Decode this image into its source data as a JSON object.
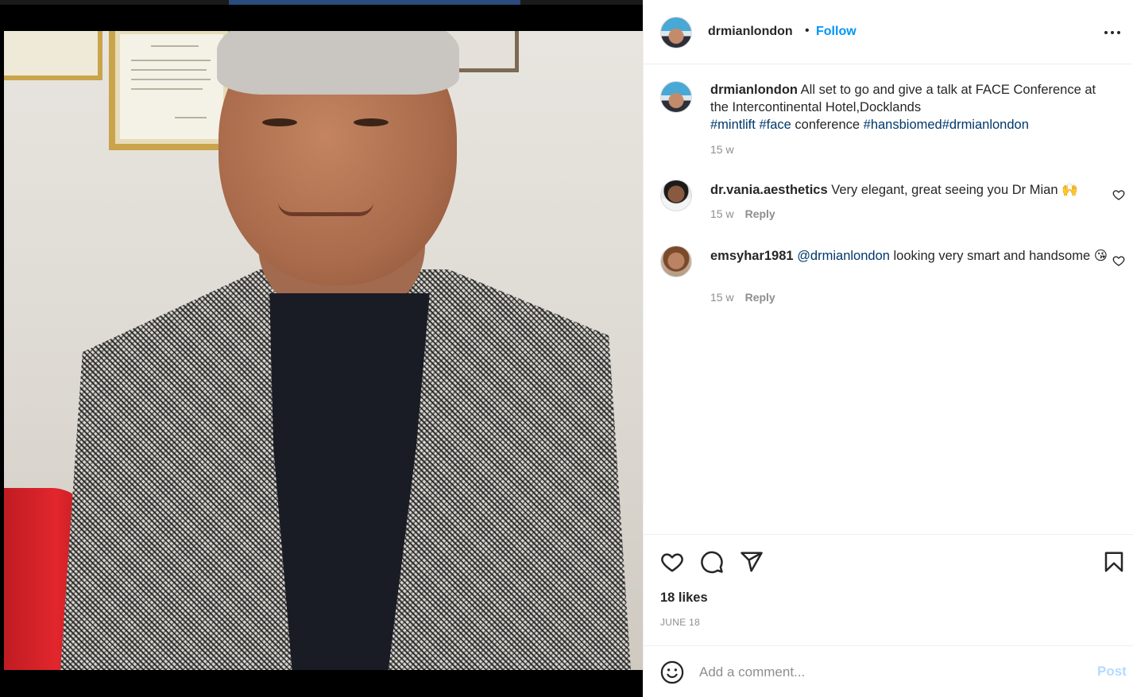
{
  "post": {
    "username": "drmianlondon",
    "separator": "•",
    "follow_label": "Follow",
    "more_icon": "more-horizontal-icon",
    "image_alt": "Man in houndstooth blazer and navy t-shirt smiling"
  },
  "caption": {
    "username": "drmianlondon",
    "text": " All set to go and give a talk at FACE Conference at the Intercontinental Hotel,Docklands",
    "tag1": "#mintlift",
    "tag2": "#face",
    "word": " conference ",
    "tag3": "#hansbiomed",
    "tag4": "#drmianlondon",
    "age": "15 w"
  },
  "comments": [
    {
      "username": "dr.vania.aesthetics",
      "text": " Very elegant, great seeing you Dr Mian 🙌",
      "age": "15 w",
      "reply_label": "Reply"
    },
    {
      "username": "emsyhar1981",
      "mention": "@drmianlondon",
      "text": " looking very smart and handsome 😘",
      "age": "15 w",
      "reply_label": "Reply"
    }
  ],
  "actions": {
    "icons": [
      "heart-icon",
      "comment-icon",
      "share-icon",
      "bookmark-icon"
    ],
    "likes": "18 likes",
    "date": "JUNE 18"
  },
  "composer": {
    "placeholder": "Add a comment...",
    "post_label": "Post",
    "emoji_icon": "smiley-icon"
  },
  "colors": {
    "accent": "#0095f6",
    "hashtag": "#00376b",
    "muted": "#8e8e8e",
    "text": "#262626",
    "post_disabled": "#b3dbff"
  }
}
